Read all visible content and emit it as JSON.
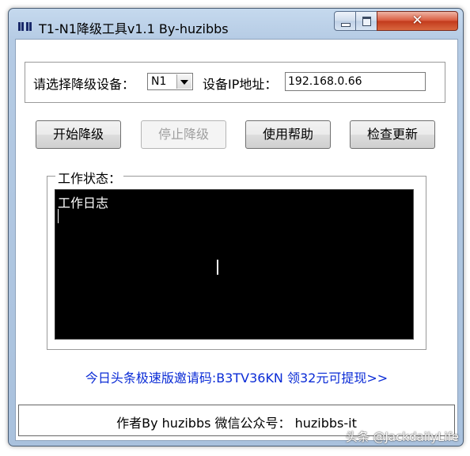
{
  "window": {
    "title": "T1-N1降级工具v1.1 By-huzibbs",
    "close_glyph": "✕"
  },
  "device": {
    "select_label": "请选择降级设备：",
    "selected_value": "N1",
    "ip_label": "设备IP地址：",
    "ip_value": "192.168.0.66"
  },
  "buttons": {
    "start": "开始降级",
    "stop": "停止降级",
    "help": "使用帮助",
    "update": "检查更新"
  },
  "status": {
    "group_label": "工作状态：",
    "log_text": "工作日志"
  },
  "promo": {
    "link_text": "今日头条极速版邀请码:B3TV36KN 领32元可提现>>"
  },
  "footer": {
    "text": "作者By huzibbs 微信公众号：  huzibbs-it"
  },
  "watermark": {
    "text": "头条 @JackdailyLife"
  },
  "colors": {
    "link": "#0a2bd6",
    "log_bg": "#000000",
    "log_text": "#ffffff"
  },
  "icons": {
    "app": "app-icon",
    "minimize": "minimize-icon",
    "maximize": "maximize-icon",
    "close": "close-icon",
    "combo": "chevron-down-icon",
    "cursor": "text-cursor-icon"
  }
}
